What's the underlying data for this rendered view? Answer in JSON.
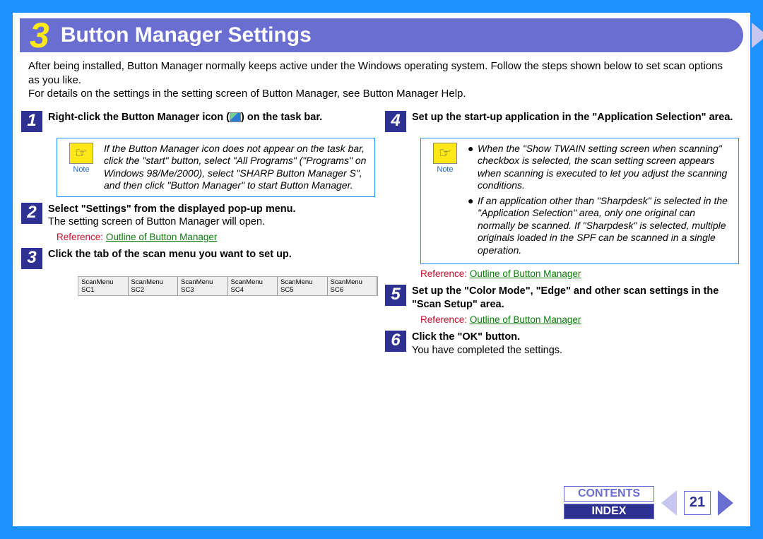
{
  "chapter_number": "3",
  "title": "Button Manager Settings",
  "intro_p1": "After being installed, Button Manager normally keeps active under the Windows operating system. Follow the steps shown below to set scan options as you like.",
  "intro_p2": "For details on the settings in the setting screen of Button Manager, see Button Manager Help.",
  "step1_n": "1",
  "step1_h_a": "Right-click the Button Manager icon (",
  "step1_h_b": ") on the task bar.",
  "note1": "If the Button Manager icon does not appear on the task bar, click the \"start\" button, select \"All Programs\" (\"Programs\" on Windows 98/Me/2000), select \"SHARP Button Manager S\", and then click \"Button Manager\" to start Button Manager.",
  "note_label": "Note",
  "step2_n": "2",
  "step2_h": "Select \"Settings\" from the displayed pop-up menu.",
  "step2_b": "The setting screen of Button Manager will open.",
  "ref_label": "Reference:",
  "ref_link": "Outline of Button Manager",
  "step3_n": "3",
  "step3_h": "Click the tab of the scan menu you want to set up.",
  "tabs": [
    "ScanMenu SC1",
    "ScanMenu SC2",
    "ScanMenu SC3",
    "ScanMenu SC4",
    "ScanMenu SC5",
    "ScanMenu SC6"
  ],
  "step4_n": "4",
  "step4_h": "Set up the start-up application in the \"Application Selection\" area.",
  "note4_b1": "When the \"Show TWAIN setting screen when scanning\" checkbox is selected, the scan setting screen appears when scanning is executed to let you adjust the scanning conditions.",
  "note4_b2": "If an application other than \"Sharpdesk\" is selected in the \"Application Selection\" area, only one original can normally be scanned. If \"Sharpdesk\" is selected, multiple originals loaded in the SPF can be scanned in a single operation.",
  "step5_n": "5",
  "step5_h": "Set up the \"Color Mode\", \"Edge\" and other scan settings in the \"Scan Setup\" area.",
  "step6_n": "6",
  "step6_h": "Click the \"OK\" button.",
  "step6_b": "You have completed the settings.",
  "nav_contents": "CONTENTS",
  "nav_index": "INDEX",
  "page_number": "21"
}
